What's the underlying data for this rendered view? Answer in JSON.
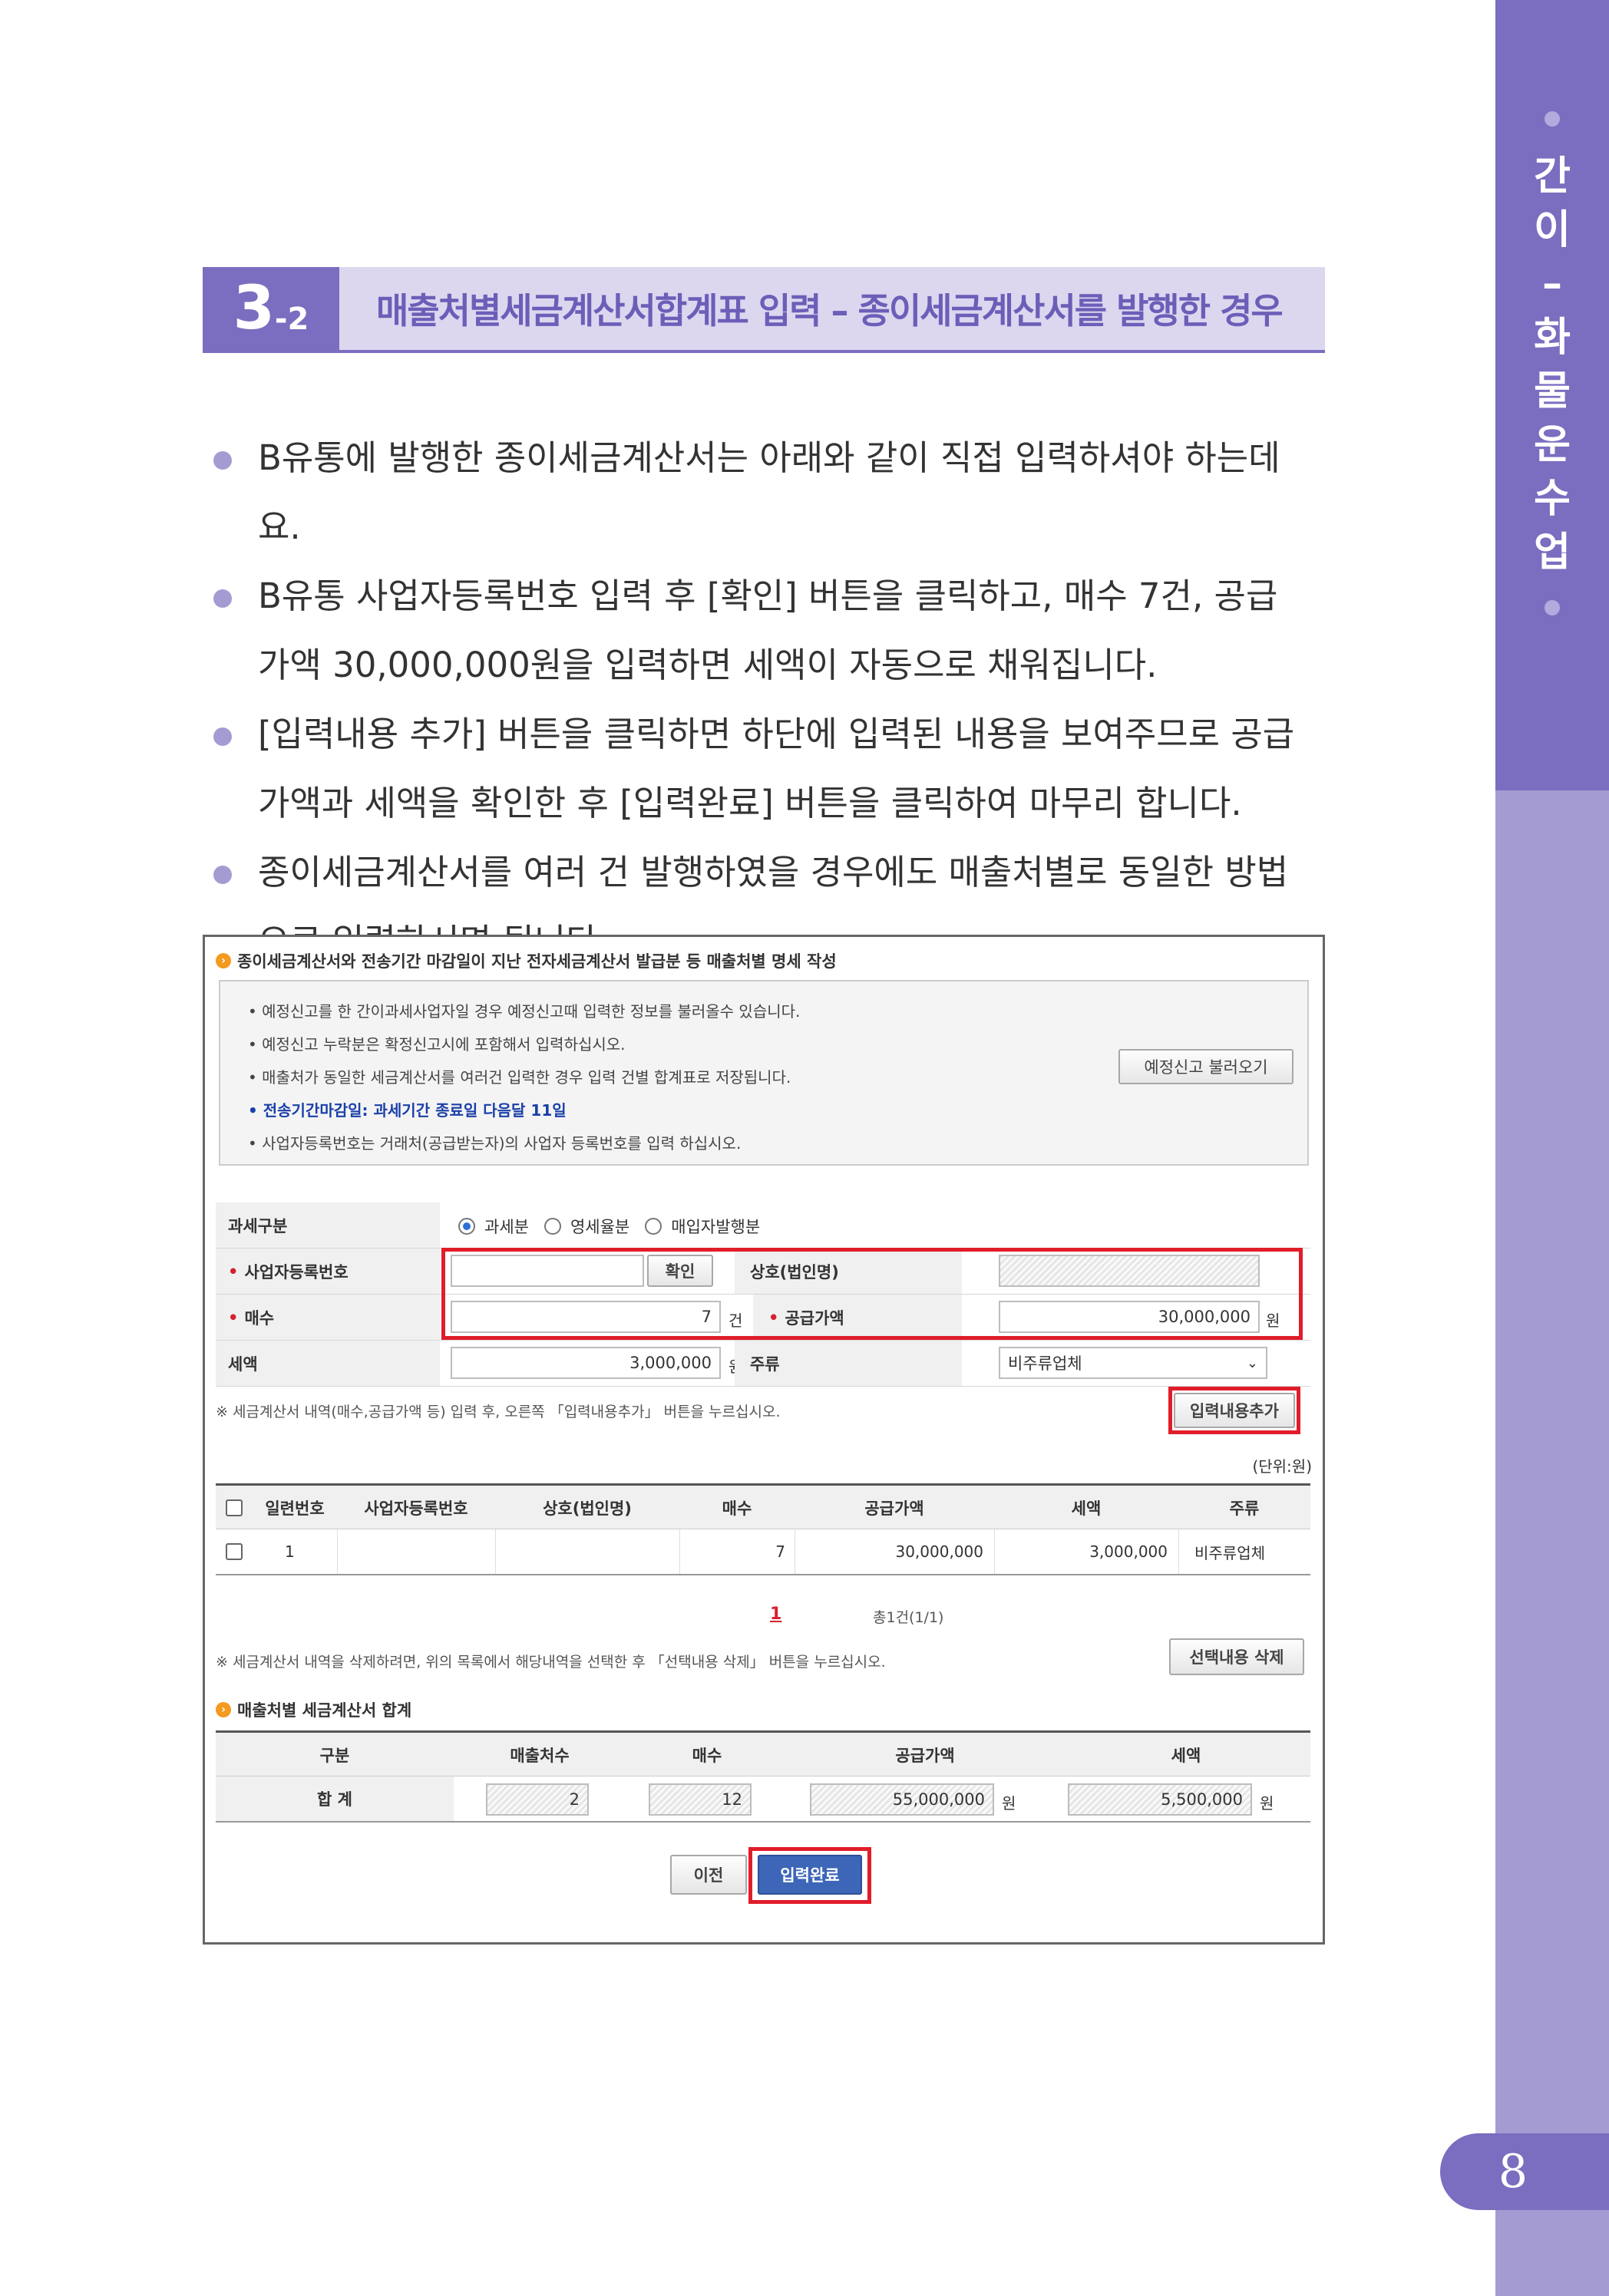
{
  "side": {
    "chars": [
      "간",
      "이",
      "–",
      "화",
      "물",
      "운",
      "수",
      "업"
    ],
    "page_number": "8"
  },
  "section": {
    "number": "3",
    "sub": "-2",
    "title": "매출처별세금계산서합계표 입력 – 종이세금계산서를 발행한 경우"
  },
  "bullets": [
    "B유통에 발행한 종이세금계산서는 아래와 같이 직접 입력하셔야 하는데요.",
    "B유통 사업자등록번호 입력 후 [확인] 버튼을 클릭하고, 매수 7건, 공급가액 30,000,000원을 입력하면 세액이 자동으로 채워집니다.",
    "[입력내용 추가] 버튼을 클릭하면 하단에 입력된 내용을 보여주므로 공급가액과 세액을 확인한 후 [입력완료] 버튼을 클릭하여 마무리 합니다.",
    "종이세금계산서를 여러 건 발행하였을 경우에도 매출처별로 동일한 방법으로 입력하시면 됩니다."
  ],
  "screen": {
    "heading": "종이세금계산서와 전송기간 마감일이 지난 전자세금계산서 발급분 등 매출처별 명세 작성",
    "notices": [
      "예정신고를 한 간이과세사업자일 경우 예정신고때 입력한 정보를 불러올수 있습니다.",
      "예정신고 누락분은 확정신고시에 포함해서 입력하십시오.",
      "매출처가 동일한 세금계산서를 여러건 입력한 경우 입력 건별 합계표로 저장됩니다.",
      "전송기간마감일: 과세기간 종료일 다음달 11일",
      "사업자등록번호는 거래처(공급받는자)의 사업자 등록번호를 입력 하십시오."
    ],
    "load_button": "예정신고 불러오기",
    "form": {
      "tax_type_label": "과세구분",
      "tax_type_options": [
        "과세분",
        "영세율분",
        "매입자발행분"
      ],
      "tax_type_selected": "과세분",
      "bizno_label": "사업자등록번호",
      "bizno_value": "",
      "confirm_button": "확인",
      "company_label": "상호(법인명)",
      "count_label": "매수",
      "count_value": "7",
      "count_unit": "건",
      "supply_label": "공급가액",
      "supply_value": "30,000,000",
      "won": "원",
      "tax_label": "세액",
      "tax_value": "3,000,000",
      "kind_label": "주류",
      "kind_value": "비주류업체"
    },
    "add_note": "※ 세금계산서 내역(매수,공급가액 등) 입력 후, 오른쪽 「입력내용추가」 버튼을 누르십시오.",
    "add_button": "입력내용추가",
    "unit_note": "(단위:원)",
    "table": {
      "headers": [
        "일련번호",
        "사업자등록번호",
        "상호(법인명)",
        "매수",
        "공급가액",
        "세액",
        "주류"
      ],
      "rows": [
        {
          "seq": "1",
          "bizno": "",
          "company": "",
          "count": "7",
          "supply": "30,000,000",
          "tax": "3,000,000",
          "kind": "비주류업체"
        }
      ]
    },
    "pagination": {
      "current": "1",
      "total": "총1건(1/1)"
    },
    "delete_note": "※ 세금계산서 내역을 삭제하려면, 위의 목록에서 해당내역을 선택한 후 「선택내용 삭제」 버튼을 누르십시오.",
    "delete_button": "선택내용 삭제",
    "summary": {
      "heading": "매출처별 세금계산서 합계",
      "headers": [
        "구분",
        "매출처수",
        "매수",
        "공급가액",
        "세액"
      ],
      "row_label": "합 계",
      "customers": "2",
      "count": "12",
      "supply": "55,000,000",
      "tax": "5,500,000",
      "won": "원"
    },
    "prev_button": "이전",
    "done_button": "입력완료"
  },
  "colors": {
    "accent": "#7b6dbf",
    "accent_light": "#a59bd3",
    "highlight_red": "#e11d2a",
    "done_button": "#3d66b8"
  }
}
